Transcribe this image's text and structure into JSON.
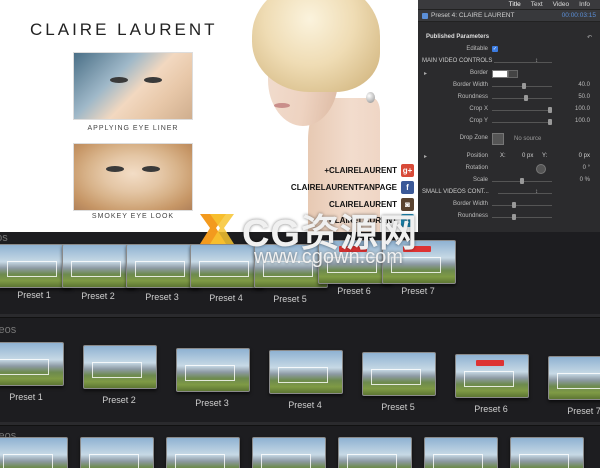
{
  "promo": {
    "brand": "CLAIRE LAURENT",
    "thumbs": [
      {
        "label": "APPLYING EYE LINER"
      },
      {
        "label": "SMOKEY EYE LOOK"
      }
    ],
    "social": [
      {
        "text": "+CLAIRELAURENT",
        "icon": "google-plus-icon",
        "glyph": "g+"
      },
      {
        "text": "CLAIRELAURENTFANPAGE",
        "icon": "facebook-icon",
        "glyph": "f"
      },
      {
        "text": "CLAIRELAURENT",
        "icon": "instagram-icon",
        "glyph": "◙"
      },
      {
        "text": "CLAIRELAURENT",
        "icon": "twitter-icon",
        "glyph": "t"
      }
    ]
  },
  "inspector": {
    "tabs": [
      "Title",
      "Text",
      "Video",
      "Info"
    ],
    "active_tab": "Title",
    "header_title": "Preset 4: CLAIRE LAURENT",
    "timecode": "00:00:03:15",
    "section_published": "Published Parameters",
    "editable_label": "Editable",
    "main_video_controls": "MAIN VIDEO CONTROLS",
    "border_label": "Border",
    "border_width_label": "Border Width",
    "border_width_value": "40.0",
    "roundness_label": "Roundness",
    "roundness_value": "50.0",
    "crop_x_label": "Crop X",
    "crop_x_value": "100.0",
    "crop_y_label": "Crop Y",
    "crop_y_value": "100.0",
    "drop_zone_label": "Drop Zone",
    "no_source": "No source",
    "position_label": "Position",
    "x_label": "X:",
    "x_value": "0 px",
    "y_label": "Y:",
    "y_value": "0 px",
    "rotation_label": "Rotation",
    "rotation_value": "0 °",
    "scale_label": "Scale",
    "scale_value": "0 %",
    "small_videos_controls": "SMALL VIDEOS CONT...",
    "small_border_width_label": "Border Width",
    "small_roundness_label": "Roundness"
  },
  "browser": {
    "shelves": [
      {
        "title": "eos",
        "presets": [
          "Preset 1",
          "Preset 2",
          "Preset 3",
          "Preset 4",
          "Preset 5",
          "Preset 6",
          "Preset 7"
        ]
      },
      {
        "title": "ideos",
        "presets": [
          "Preset 1",
          "Preset 2",
          "Preset 3",
          "Preset 4",
          "Preset 5",
          "Preset 6",
          "Preset 7"
        ]
      },
      {
        "title": "ideos",
        "presets": []
      }
    ]
  },
  "watermark": {
    "text": "CG资源网",
    "url": "www.cgown.com"
  }
}
